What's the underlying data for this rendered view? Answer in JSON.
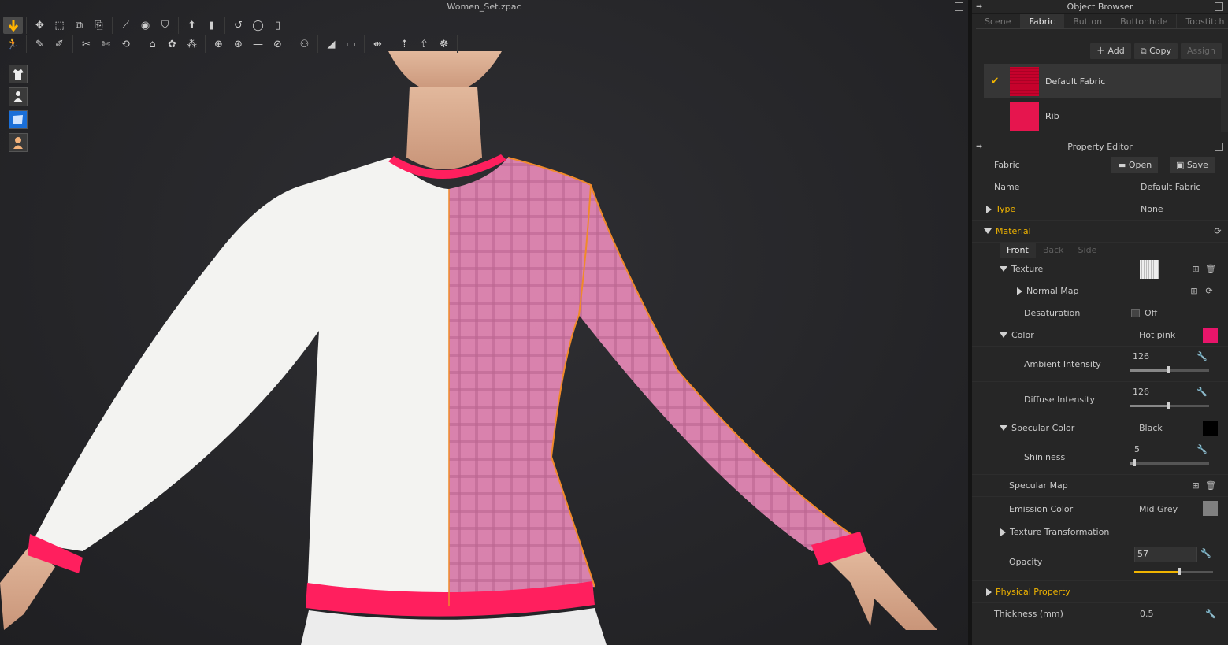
{
  "viewport": {
    "file_title": "Women_Set.zpac",
    "toolbar_row1_icons": [
      "select-move-icon",
      "transform-pattern-icon",
      "edit-pattern-icon",
      "edit-curvature-icon",
      "edit-point-icon",
      "polygon-icon",
      "rectangle-icon",
      "sewing-icon",
      "free-sewing-icon",
      "tack-icon",
      "fold-arrangement-icon",
      "strap-icon",
      "measure-icon"
    ],
    "toolbar_row2_icons": [
      "avatar-pose-icon",
      "pin-icon",
      "pin-box-icon",
      "fold-icon",
      "flatten-icon",
      "reset-icon",
      "hanger-icon",
      "button-icon",
      "buttonhole-icon",
      "topstitch-icon",
      "line-icon",
      "zipper-icon",
      "measurement-icon",
      "puckering-icon",
      "segment-icon",
      "piping-icon",
      "trace-icon",
      "texture-icon",
      "graphic-icon"
    ],
    "side_tools": [
      "show-garment-icon",
      "show-avatar-icon",
      "show-fabric-icon",
      "avatar-skin-icon"
    ]
  },
  "object_browser": {
    "title": "Object Browser",
    "tabs": [
      "Scene",
      "Fabric",
      "Button",
      "Buttonhole",
      "Topstitch"
    ],
    "active_tab": "Fabric",
    "add_label": "Add",
    "copy_label": "Copy",
    "assign_label": "Assign",
    "fabrics": [
      {
        "name": "Default Fabric",
        "selected": true,
        "swatch_color": "#e1186a"
      },
      {
        "name": "Rib",
        "selected": false,
        "swatch_color": "#e6154e"
      }
    ]
  },
  "property_editor": {
    "title": "Property Editor",
    "fabric_label": "Fabric",
    "open_label": "Open",
    "save_label": "Save",
    "name_label": "Name",
    "name_value": "Default Fabric",
    "type_label": "Type",
    "type_value": "None",
    "material_label": "Material",
    "material_tabs": [
      "Front",
      "Back",
      "Side"
    ],
    "texture_label": "Texture",
    "normal_map_label": "Normal Map",
    "desaturation_label": "Desaturation",
    "desaturation_value": "Off",
    "color_label": "Color",
    "color_value": "Hot pink",
    "color_hex": "#e8156a",
    "ambient_label": "Ambient Intensity",
    "ambient_value": "126",
    "ambient_fraction": 0.49,
    "diffuse_label": "Diffuse Intensity",
    "diffuse_value": "126",
    "diffuse_fraction": 0.49,
    "specular_color_label": "Specular Color",
    "specular_color_value": "Black",
    "specular_hex": "#000000",
    "shininess_label": "Shininess",
    "shininess_value": "5",
    "shininess_fraction": 0.05,
    "specular_map_label": "Specular Map",
    "emission_label": "Emission Color",
    "emission_value": "Mid Grey",
    "emission_hex": "#808080",
    "texture_transform_label": "Texture Transformation",
    "opacity_label": "Opacity",
    "opacity_value": "57",
    "opacity_fraction": 0.57,
    "physical_label": "Physical Property",
    "thickness_label": "Thickness (mm)",
    "thickness_value": "0.5"
  }
}
